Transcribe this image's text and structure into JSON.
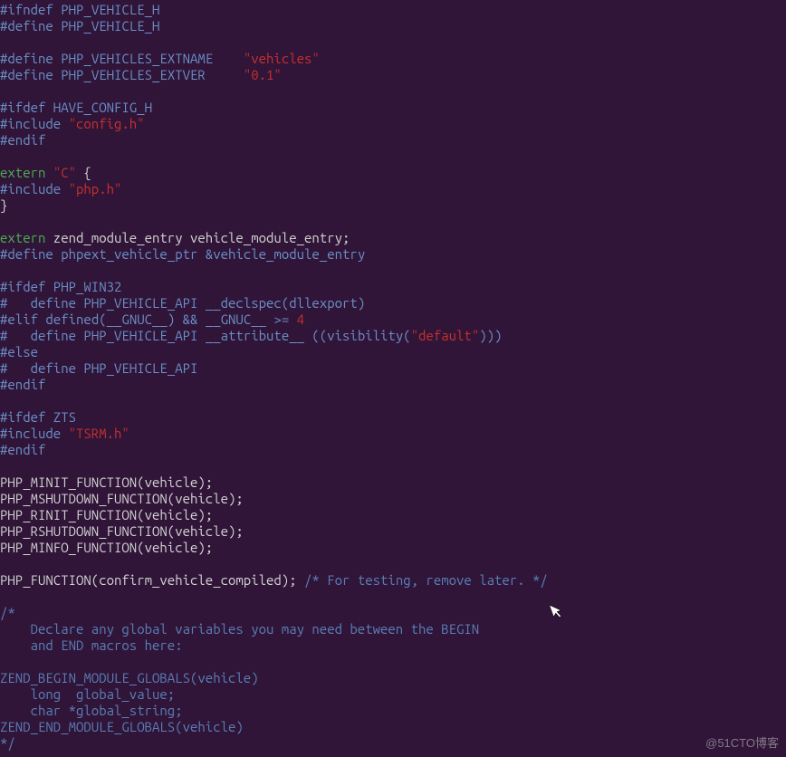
{
  "code": {
    "l01a": "#ifndef",
    "l01b": " PHP_VEHICLE_H",
    "l02a": "#define",
    "l02b": " PHP_VEHICLE_H",
    "l03": "",
    "l04a": "#define",
    "l04b": " PHP_VEHICLES_EXTNAME    ",
    "l04c": "\"vehicles\"",
    "l05a": "#define",
    "l05b": " PHP_VEHICLES_EXTVER     ",
    "l05c": "\"0.1\"",
    "l06": "",
    "l07a": "#ifdef",
    "l07b": " HAVE_CONFIG_H",
    "l08a": "#include",
    "l08b": " ",
    "l08c": "\"config.h\"",
    "l09a": "#endif",
    "l10": "",
    "l11a": "extern",
    "l11b": " ",
    "l11c": "\"C\"",
    "l11d": " {",
    "l12a": "#include",
    "l12b": " ",
    "l12c": "\"php.h\"",
    "l13": "}",
    "l14": "",
    "l15a": "extern",
    "l15b": " zend_module_entry vehicle_module_entry;",
    "l16a": "#define",
    "l16b": " phpext_vehicle_ptr &vehicle_module_entry",
    "l17": "",
    "l18a": "#ifdef",
    "l18b": " PHP_WIN32",
    "l19a": "#   define",
    "l19b": " PHP_VEHICLE_API __declspec(dllexport)",
    "l20a": "#elif",
    "l20b": " defined(__GNUC__) && __GNUC__ >= ",
    "l20c": "4",
    "l21a": "#   define",
    "l21b": " PHP_VEHICLE_API __attribute__ ((visibility(",
    "l21c": "\"default\"",
    "l21d": ")))",
    "l22a": "#else",
    "l23a": "#   define",
    "l23b": " PHP_VEHICLE_API",
    "l24a": "#endif",
    "l25": "",
    "l26a": "#ifdef",
    "l26b": " ZTS",
    "l27a": "#include",
    "l27b": " ",
    "l27c": "\"TSRM.h\"",
    "l28a": "#endif",
    "l29": "",
    "l30": "PHP_MINIT_FUNCTION(vehicle);",
    "l31": "PHP_MSHUTDOWN_FUNCTION(vehicle);",
    "l32": "PHP_RINIT_FUNCTION(vehicle);",
    "l33": "PHP_RSHUTDOWN_FUNCTION(vehicle);",
    "l34": "PHP_MINFO_FUNCTION(vehicle);",
    "l35": "",
    "l36a": "PHP_FUNCTION(confirm_vehicle_compiled); ",
    "l36b": "/* For testing, remove later. */",
    "l37": "",
    "l38": "/*",
    "l39": "    Declare any global variables you may need between the BEGIN",
    "l40": "    and END macros here:",
    "l41": "",
    "l42": "ZEND_BEGIN_MODULE_GLOBALS(vehicle)",
    "l43": "    long  global_value;",
    "l44": "    char *global_string;",
    "l45": "ZEND_END_MODULE_GLOBALS(vehicle)",
    "l46": "*/"
  },
  "watermark": "@51CTO博客"
}
